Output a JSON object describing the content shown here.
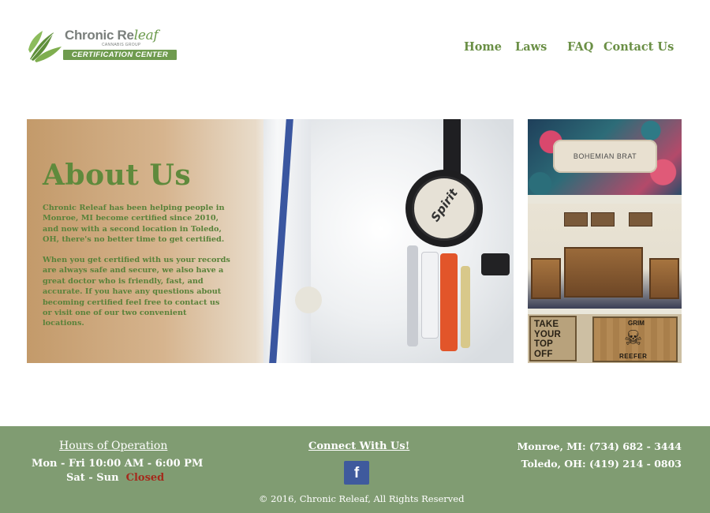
{
  "header": {
    "logo": {
      "brand": "Chronic Re",
      "brand_italic": "leaf",
      "tagline": "CANNABIS GROUP",
      "banner": "CERTIFICATION CENTER"
    },
    "nav": {
      "home": "Home",
      "laws": "Laws",
      "faq": "FAQ",
      "contact": "Contact Us"
    },
    "colors": {
      "accent_green": "#6a8f45"
    }
  },
  "hero": {
    "title": "About Us",
    "paragraph_1": "Chronic Releaf has been helping people in Monroe, MI become certified since 2010, and now with a second location in Toledo, OH, there's no better time to get certified.",
    "paragraph_2": "When you get certified with us your records are always safe and secure, we also have a great doctor who is friendly, fast, and accurate. If you have any questions about becoming certified feel free to contact us or visit one of our two convenient locations.",
    "stethoscope_label": "Spirit"
  },
  "gallery": {
    "plaque_text": "BOHEMIAN BRAT",
    "sign_take": "TAKE YOUR TOP OFF",
    "sign_grim_top": "GRIM",
    "sign_grim_bottom": "REEFER"
  },
  "footer": {
    "hours_title": "Hours of Operation",
    "hours_weekday": "Mon - Fri  10:00 AM - 6:00 PM",
    "hours_weekend_label": "Sat - Sun",
    "hours_weekend_value": "Closed",
    "connect_title": "Connect With Us!",
    "facebook_glyph": "f",
    "phone_monroe": "Monroe, MI:  (734) 682 - 3444",
    "phone_toledo": "Toledo, OH:   (419) 214 - 0803",
    "copyright": "© 2016, Chronic Releaf, All Rights Reserved",
    "colors": {
      "background": "#809c72",
      "closed": "#a42b1d",
      "facebook": "#3f5a9d"
    }
  }
}
